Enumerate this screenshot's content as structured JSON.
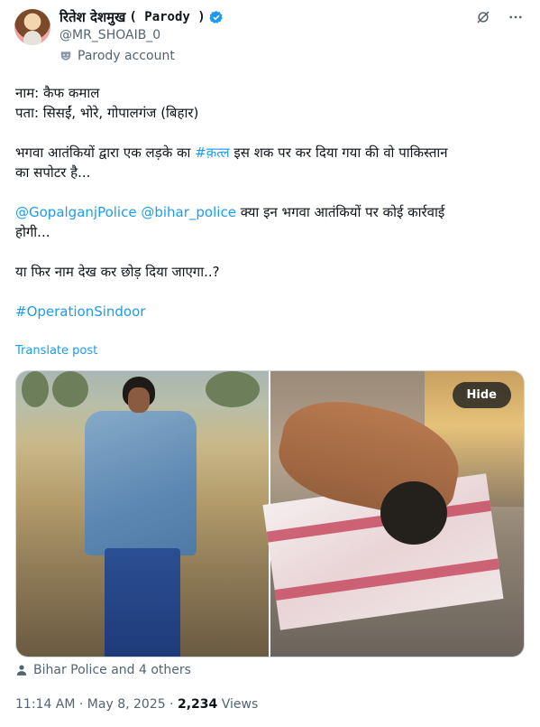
{
  "header": {
    "display_name": "रितेश देशमुख",
    "parody_tag": "( Parody )",
    "handle": "@MR_SHOAIB_0",
    "label": "Parody account"
  },
  "post": {
    "line1": "नाम: कैफ कमाल",
    "line2": "पता: सिसईं, भोरे, गोपालगंज (बिहार)",
    "line3_pre": "भगवा आतंकियों द्वारा एक लड़के का ",
    "line3_tag": "#क़त्ल",
    "line3_post": " इस शक पर कर दिया गया की वो पाकिस्तान",
    "line4": "का सपोटर है...",
    "mention1": "@GopalganjPolice",
    "mention2": "@bihar_police",
    "line5_post": " क्या इन भगवा आतंकियों पर कोई कार्रवाई",
    "line6": "होगी...",
    "line7": "या फिर नाम देख कर छोड़ दिया जाएगा..?",
    "hashtag": "#OperationSindoor",
    "translate": "Translate post"
  },
  "media": {
    "hide_label": "Hide"
  },
  "tagged": "Bihar Police and 4 others",
  "meta": {
    "time_date": "11:14 AM · May 8, 2025 · ",
    "views_count": "2,234",
    "views_label": " Views"
  },
  "colors": {
    "accent": "#1d9bf0",
    "secondary_text": "#536471"
  },
  "icons": [
    "verified-icon",
    "grok-icon",
    "more-icon",
    "parody-mask-icon",
    "person-icon"
  ]
}
